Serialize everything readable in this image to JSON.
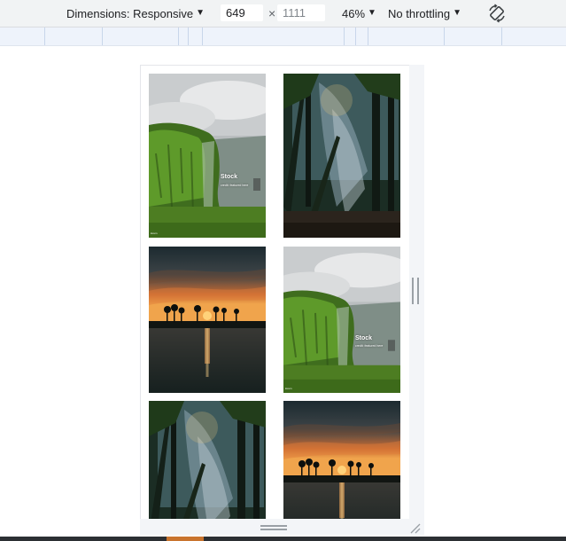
{
  "toolbar": {
    "dimensions_label": "Dimensions: Responsive",
    "width_value": "649",
    "times_symbol": "×",
    "height_placeholder": "1111",
    "zoom_label": "46%",
    "throttling_label": "No throttling",
    "rotate_icon": "rotate-icon"
  },
  "gallery": {
    "photos": [
      {
        "scene": "green cliff waterfall",
        "title": "Stock",
        "subtitle": "credit: featured here",
        "corner": "lorem"
      },
      {
        "scene": "misty forest with sunbeams"
      },
      {
        "scene": "sunset over lake with palm silhouettes"
      },
      {
        "scene": "green cliff waterfall",
        "title": "Stock",
        "subtitle": "credit: featured here",
        "corner": "lorem"
      },
      {
        "scene": "misty forest with sunbeams"
      },
      {
        "scene": "sunset over lake with palm silhouettes"
      }
    ]
  },
  "colors": {
    "toolbar_bg": "#f1f3f4",
    "ruler_bg": "#eef3fb",
    "handle_bg": "#f3f5f8"
  }
}
